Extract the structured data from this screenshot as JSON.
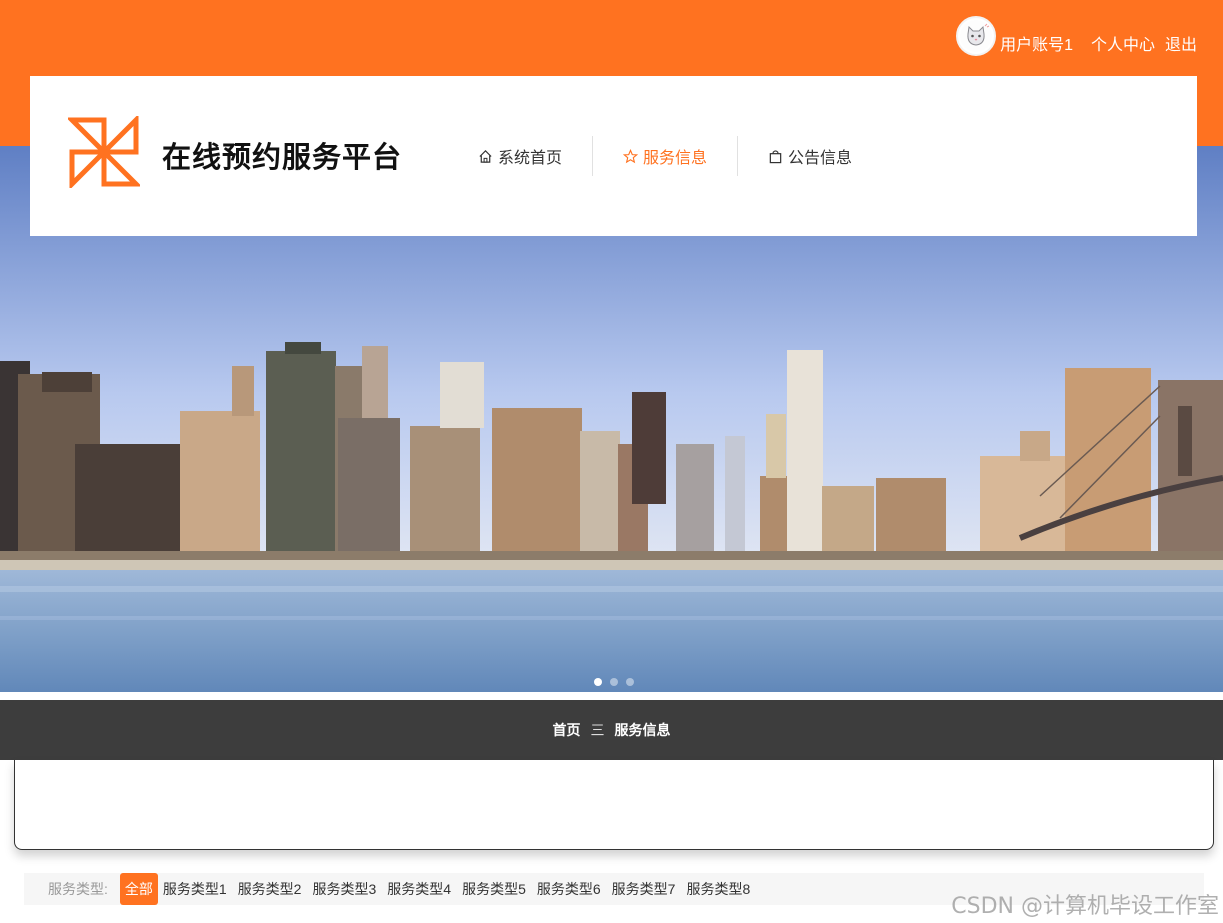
{
  "colors": {
    "accent": "#ff7220",
    "dark_bar": "#3d3d3d",
    "filter_bg": "#f6f6f6"
  },
  "user": {
    "account": "用户账号1",
    "personal_center": "个人中心",
    "logout": "退出",
    "avatar_icon": "cat-avatar-icon"
  },
  "site": {
    "title": "在线预约服务平台",
    "logo_icon": "pinwheel-logo-icon"
  },
  "nav": [
    {
      "label": "系统首页",
      "icon": "home-icon",
      "active": false
    },
    {
      "label": "服务信息",
      "icon": "star-icon",
      "active": true
    },
    {
      "label": "公告信息",
      "icon": "bag-icon",
      "active": false
    }
  ],
  "carousel": {
    "image": "city-skyline",
    "slides": 3,
    "current": 1
  },
  "breadcrumb": {
    "home": "首页",
    "separator": "三",
    "current": "服务信息"
  },
  "filter": {
    "label": "服务类型:",
    "items": [
      "全部",
      "服务类型1",
      "服务类型2",
      "服务类型3",
      "服务类型4",
      "服务类型5",
      "服务类型6",
      "服务类型7",
      "服务类型8"
    ],
    "selected": "全部"
  },
  "watermark": "CSDN @计算机毕设工作室"
}
